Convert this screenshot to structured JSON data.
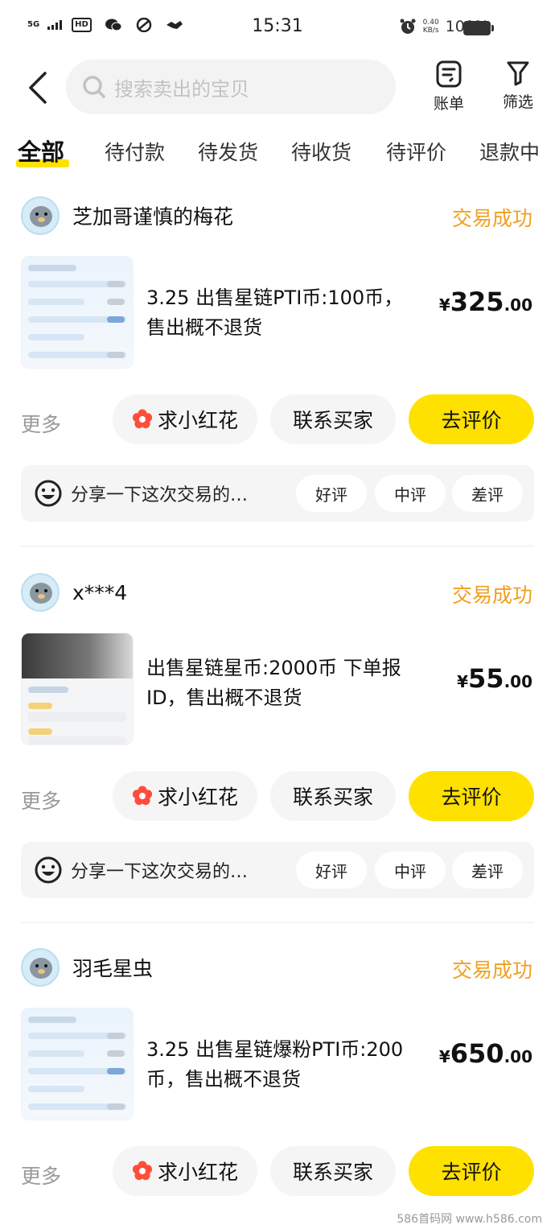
{
  "status_bar": {
    "network": "5G",
    "hd": "HD",
    "time": "15:31",
    "speed_value": "0.40",
    "speed_unit": "KB/s",
    "battery": "100%"
  },
  "header": {
    "search_placeholder": "搜索卖出的宝贝",
    "bill_label": "账单",
    "filter_label": "筛选"
  },
  "tabs": [
    {
      "label": "全部",
      "active": true
    },
    {
      "label": "待付款"
    },
    {
      "label": "待发货"
    },
    {
      "label": "待收货"
    },
    {
      "label": "待评价"
    },
    {
      "label": "退款中"
    }
  ],
  "orders": [
    {
      "seller": "芝加哥谨慎的梅花",
      "status": "交易成功",
      "title": "3.25 出售星链PTI币:100币，售出概不退货",
      "price_currency": "¥",
      "price_int": "325",
      "price_dec": ".00",
      "more": "更多",
      "flower_btn": "求小红花",
      "contact_btn": "联系买家",
      "review_btn": "去评价",
      "review_hint": "分享一下这次交易的…",
      "good": "好评",
      "neutral": "中评",
      "bad": "差评"
    },
    {
      "seller": "x***4",
      "status": "交易成功",
      "title": "出售星链星币:2000币 下单报ID，售出概不退货",
      "price_currency": "¥",
      "price_int": "55",
      "price_dec": ".00",
      "more": "更多",
      "flower_btn": "求小红花",
      "contact_btn": "联系买家",
      "review_btn": "去评价",
      "review_hint": "分享一下这次交易的…",
      "good": "好评",
      "neutral": "中评",
      "bad": "差评"
    },
    {
      "seller": "羽毛星虫",
      "status": "交易成功",
      "title": "3.25 出售星链爆粉PTI币:200币，售出概不退货",
      "price_currency": "¥",
      "price_int": "650",
      "price_dec": ".00",
      "more": "更多",
      "flower_btn": "求小红花",
      "contact_btn": "联系买家",
      "review_btn": "去评价"
    }
  ],
  "watermark": "586首码网 www.h586.com"
}
